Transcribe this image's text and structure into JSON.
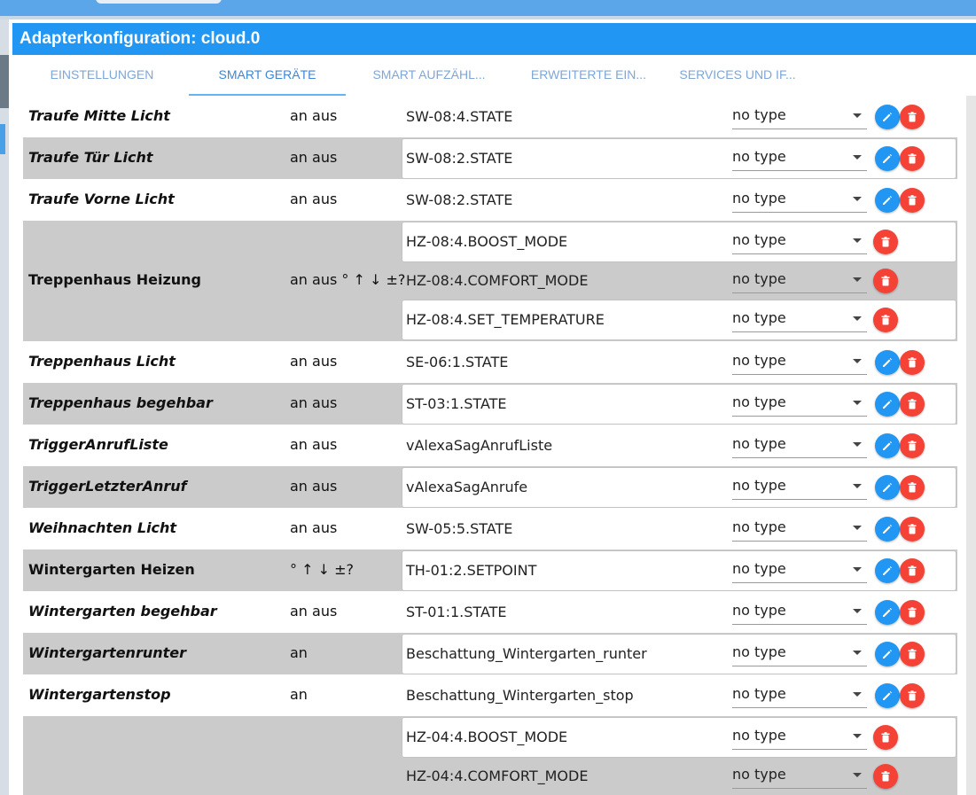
{
  "dialog": {
    "title": "Adapterkonfiguration: cloud.0"
  },
  "tabs": [
    {
      "label": "EINSTELLUNGEN",
      "active": false
    },
    {
      "label": "SMART GERÄTE",
      "active": true
    },
    {
      "label": "SMART AUFZÄHL...",
      "active": false
    },
    {
      "label": "ERWEITERTE EIN...",
      "active": false
    },
    {
      "label": "SERVICES UND IF...",
      "active": false
    }
  ],
  "devices": [
    {
      "name": "Traufe Mitte Licht",
      "italic": true,
      "traits": "an aus",
      "states": [
        {
          "id": "SW-08:4.STATE",
          "type": "no type",
          "editable": true
        }
      ]
    },
    {
      "name": "Traufe Tür Licht",
      "italic": true,
      "traits": "an aus",
      "states": [
        {
          "id": "SW-08:2.STATE",
          "type": "no type",
          "editable": true
        }
      ]
    },
    {
      "name": "Traufe Vorne Licht",
      "italic": true,
      "traits": "an aus",
      "states": [
        {
          "id": "SW-08:2.STATE",
          "type": "no type",
          "editable": true
        }
      ]
    },
    {
      "name": "Treppenhaus Heizung",
      "italic": false,
      "traits": "an aus ° ↑ ↓ ±?",
      "states": [
        {
          "id": "HZ-08:4.BOOST_MODE",
          "type": "no type",
          "editable": false
        },
        {
          "id": "HZ-08:4.COMFORT_MODE",
          "type": "no type",
          "editable": false
        },
        {
          "id": "HZ-08:4.SET_TEMPERATURE",
          "type": "no type",
          "editable": false
        }
      ]
    },
    {
      "name": "Treppenhaus Licht",
      "italic": true,
      "traits": "an aus",
      "states": [
        {
          "id": "SE-06:1.STATE",
          "type": "no type",
          "editable": true
        }
      ]
    },
    {
      "name": "Treppenhaus begehbar",
      "italic": true,
      "traits": "an aus",
      "states": [
        {
          "id": "ST-03:1.STATE",
          "type": "no type",
          "editable": true
        }
      ]
    },
    {
      "name": "TriggerAnrufListe",
      "italic": true,
      "traits": "an aus",
      "states": [
        {
          "id": "vAlexaSagAnrufListe",
          "type": "no type",
          "editable": true
        }
      ]
    },
    {
      "name": "TriggerLetzterAnruf",
      "italic": true,
      "traits": "an aus",
      "states": [
        {
          "id": "vAlexaSagAnrufe",
          "type": "no type",
          "editable": true
        }
      ]
    },
    {
      "name": "Weihnachten Licht",
      "italic": true,
      "traits": "an aus",
      "states": [
        {
          "id": "SW-05:5.STATE",
          "type": "no type",
          "editable": true
        }
      ]
    },
    {
      "name": "Wintergarten Heizen",
      "italic": false,
      "traits": "° ↑ ↓ ±?",
      "states": [
        {
          "id": "TH-01:2.SETPOINT",
          "type": "no type",
          "editable": true
        }
      ]
    },
    {
      "name": "Wintergarten begehbar",
      "italic": true,
      "traits": "an aus",
      "states": [
        {
          "id": "ST-01:1.STATE",
          "type": "no type",
          "editable": true
        }
      ]
    },
    {
      "name": "Wintergartenrunter",
      "italic": true,
      "traits": "an",
      "states": [
        {
          "id": "Beschattung_Wintergarten_runter",
          "type": "no type",
          "editable": true
        }
      ]
    },
    {
      "name": "Wintergartenstop",
      "italic": true,
      "traits": "an",
      "states": [
        {
          "id": "Beschattung_Wintergarten_stop",
          "type": "no type",
          "editable": true
        }
      ]
    },
    {
      "name": "",
      "italic": false,
      "traits": "",
      "states": [
        {
          "id": "HZ-04:4.BOOST_MODE",
          "type": "no type",
          "editable": false
        },
        {
          "id": "HZ-04:4.COMFORT_MODE",
          "type": "no type",
          "editable": false
        }
      ]
    }
  ]
}
